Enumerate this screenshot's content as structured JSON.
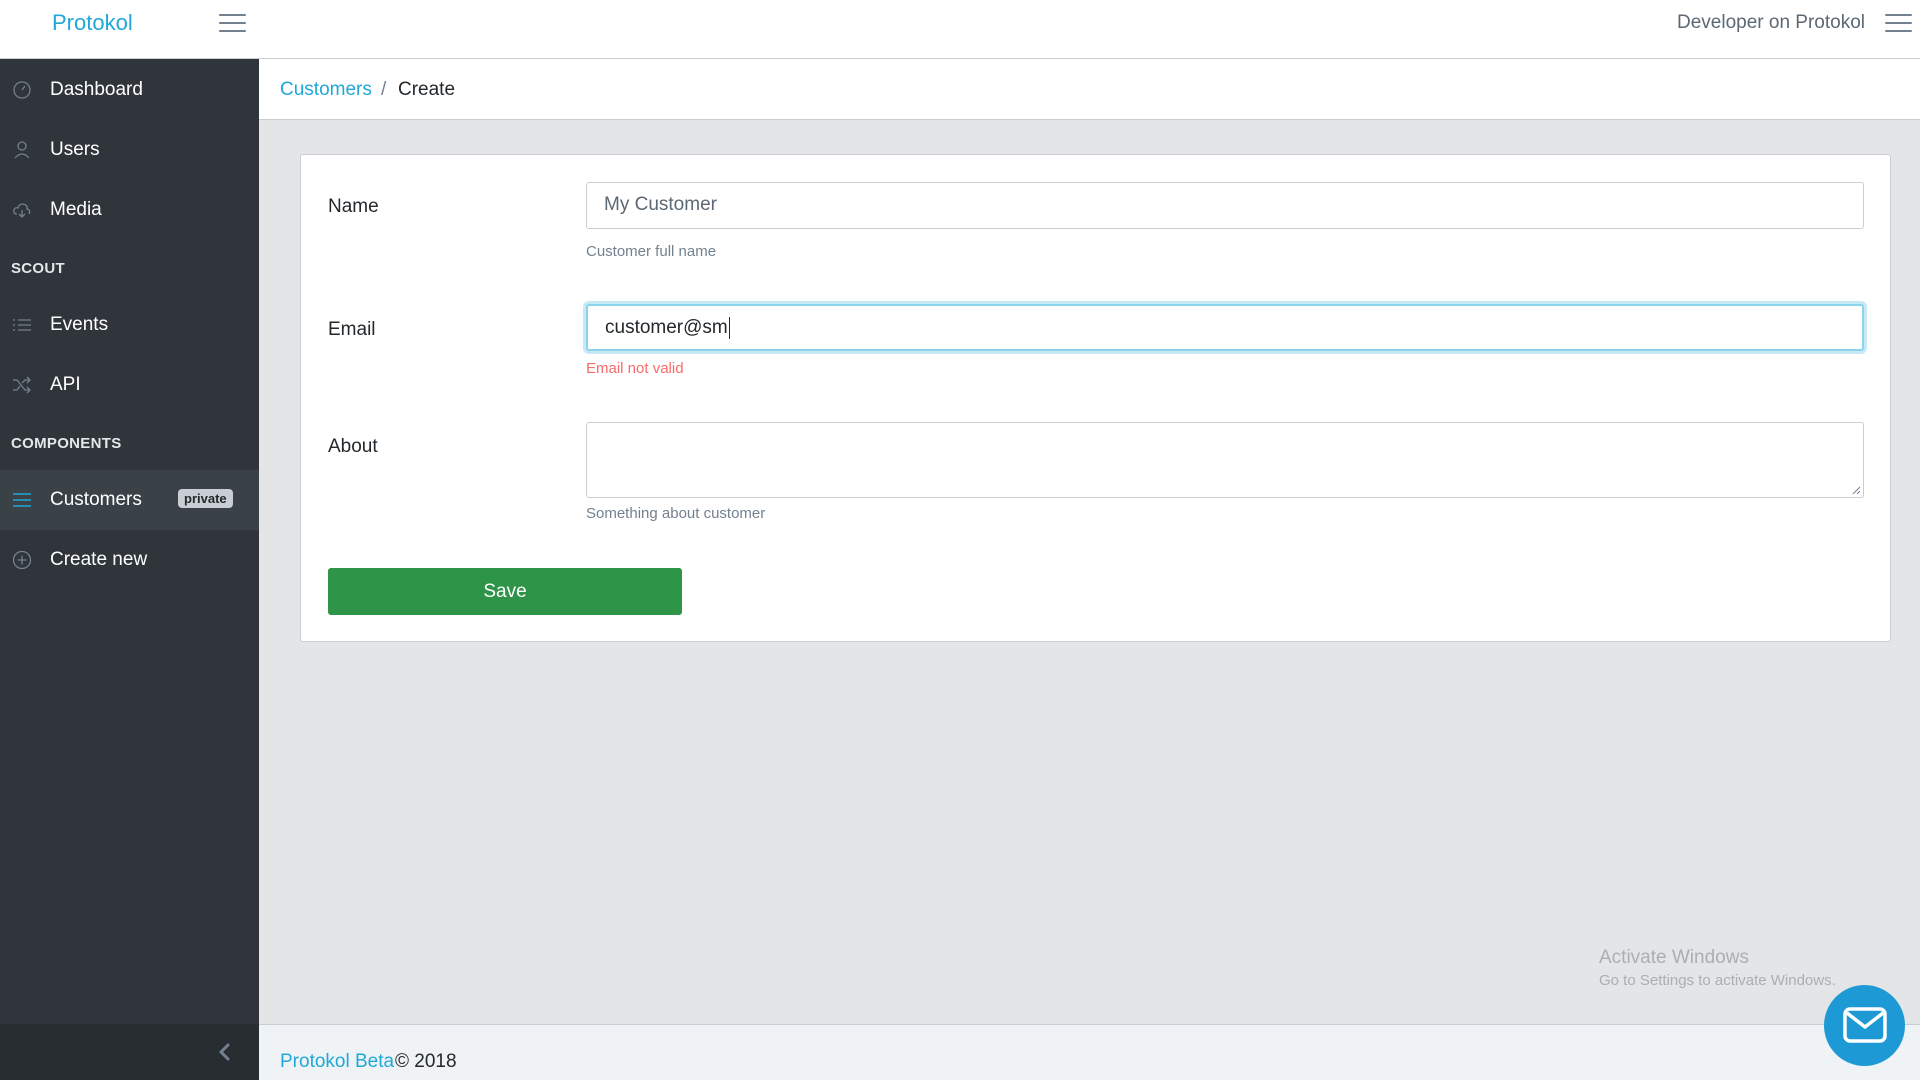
{
  "header": {
    "brand": "Protokol",
    "user_name": "Developer on Protokol"
  },
  "sidebar": {
    "items": [
      {
        "label": "Dashboard",
        "icon": "speedometer-icon"
      },
      {
        "label": "Users",
        "icon": "user-icon"
      },
      {
        "label": "Media",
        "icon": "cloud-download-icon"
      }
    ],
    "section_scout": "SCOUT",
    "scout_items": [
      {
        "label": "Events",
        "icon": "list-icon"
      },
      {
        "label": "API",
        "icon": "shuffle-icon"
      }
    ],
    "section_components": "COMPONENTS",
    "component_items": [
      {
        "label": "Customers",
        "icon": "menu-icon",
        "badge": "private",
        "active": true
      },
      {
        "label": "Create new",
        "icon": "plus-circle-icon"
      }
    ]
  },
  "breadcrumb": {
    "parent": "Customers",
    "separator": "/",
    "current": "Create"
  },
  "form": {
    "name_label": "Name",
    "name_value": "My Customer",
    "name_help": "Customer full name",
    "email_label": "Email",
    "email_value": "customer@sm",
    "email_error": "Email not valid",
    "about_label": "About",
    "about_value": "",
    "about_help": "Something about customer",
    "save_label": "Save"
  },
  "watermark": {
    "title": "Activate Windows",
    "subtitle": "Go to Settings to activate Windows."
  },
  "footer": {
    "link": "Protokol Beta",
    "text": "© 2018"
  },
  "colors": {
    "accent": "#20a8d8",
    "sidebar_bg": "#2f353a",
    "save_button": "#2e9548",
    "error": "#f86c6b"
  }
}
